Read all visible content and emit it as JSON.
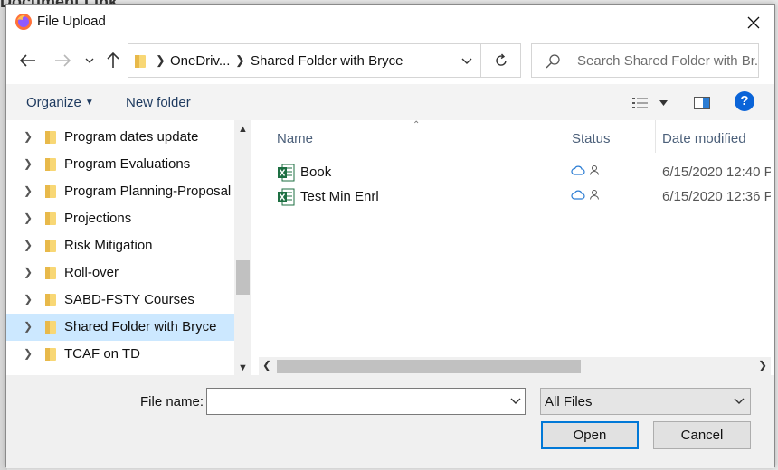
{
  "background": {
    "text": "Document Link"
  },
  "window": {
    "title": "File Upload",
    "app_icon": "firefox-icon",
    "close_icon": "close-icon"
  },
  "nav": {
    "back_icon": "back-arrow-icon",
    "forward_icon": "forward-arrow-icon",
    "recent_icon": "chevron-down-icon",
    "up_icon": "up-arrow-icon",
    "breadcrumbs": [
      "OneDriv...",
      "Shared Folder with Bryce"
    ],
    "refresh_icon": "refresh-icon",
    "search_placeholder": "Search Shared Folder with Br..."
  },
  "toolbar": {
    "organize": "Organize",
    "new_folder": "New folder",
    "help": "?"
  },
  "tree": {
    "items": [
      {
        "label": "Program dates update",
        "selected": false
      },
      {
        "label": "Program Evaluations",
        "selected": false
      },
      {
        "label": "Program Planning-Proposal",
        "selected": false
      },
      {
        "label": "Projections",
        "selected": false
      },
      {
        "label": "Risk Mitigation",
        "selected": false
      },
      {
        "label": "Roll-over",
        "selected": false
      },
      {
        "label": "SABD-FSTY Courses",
        "selected": false
      },
      {
        "label": "Shared Folder with Bryce",
        "selected": true
      },
      {
        "label": "TCAF on TD",
        "selected": false
      }
    ]
  },
  "files": {
    "columns": {
      "name": "Name",
      "status": "Status",
      "date": "Date modified"
    },
    "rows": [
      {
        "name": "Book",
        "date": "6/15/2020 12:40 P",
        "icon": "excel-icon",
        "status_icons": [
          "cloud-icon",
          "person-icon"
        ]
      },
      {
        "name": "Test Min Enrl",
        "date": "6/15/2020 12:36 P",
        "icon": "excel-icon",
        "status_icons": [
          "cloud-icon",
          "person-icon"
        ]
      }
    ]
  },
  "bottom": {
    "file_name_label": "File name:",
    "file_name_value": "",
    "filter_value": "All Files",
    "open_label": "Open",
    "cancel_label": "Cancel"
  },
  "colors": {
    "accent": "#0078d7",
    "selection": "#cce8ff",
    "help": "#0a64d8",
    "excel": "#1d6f42",
    "folder": "#f8d775"
  }
}
